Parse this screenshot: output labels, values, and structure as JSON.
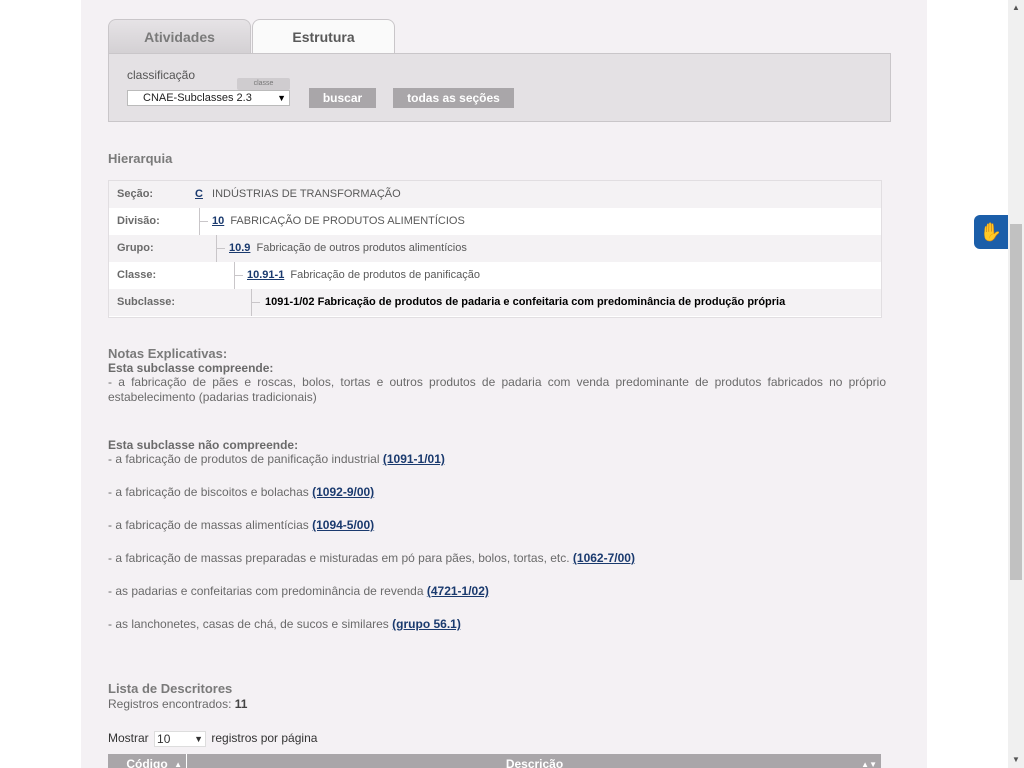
{
  "tabs": {
    "atividades": "Atividades",
    "estrutura": "Estrutura"
  },
  "search": {
    "label": "classificação",
    "tag": "classe",
    "select_value": "CNAE-Subclasses 2.3",
    "buscar": "buscar",
    "todas": "todas as seções"
  },
  "hierarchy": {
    "title": "Hierarquia",
    "rows": [
      {
        "label": "Seção:",
        "code": "C",
        "text": "INDÚSTRIAS DE TRANSFORMAÇÃO"
      },
      {
        "label": "Divisão:",
        "code": "10",
        "text": "FABRICAÇÃO DE PRODUTOS ALIMENTÍCIOS"
      },
      {
        "label": "Grupo:",
        "code": "10.9",
        "text": "Fabricação de outros produtos alimentícios"
      },
      {
        "label": "Classe:",
        "code": "10.91-1",
        "text": "Fabricação de produtos de panificação"
      },
      {
        "label": "Subclasse:",
        "code": "",
        "text": "1091-1/02 Fabricação de produtos de padaria e confeitaria com predominância de produção própria"
      }
    ]
  },
  "notes": {
    "title": "Notas Explicativas:",
    "comp_title": "Esta subclasse compreende:",
    "comp_text": "- a fabricação de pães e roscas, bolos, tortas e outros produtos de padaria com venda predominante de produtos fabricados no próprio estabelecimento (padarias tradicionais)",
    "nao_title": "Esta subclasse não compreende:",
    "nao_items": [
      {
        "text": "- a fabricação de produtos de panificação industrial ",
        "link": "(1091-1/01)"
      },
      {
        "text": "- a fabricação de biscoitos e bolachas ",
        "link": "(1092-9/00)"
      },
      {
        "text": "- a fabricação de massas alimentícias ",
        "link": "(1094-5/00)"
      },
      {
        "text": "- a fabricação de massas preparadas e misturadas em pó para pães, bolos, tortas, etc. ",
        "link": "(1062-7/00)"
      },
      {
        "text": "- as padarias e confeitarias com predominância de revenda ",
        "link": "(4721-1/02)"
      },
      {
        "text": "- as lanchonetes, casas de chá, de sucos e similares ",
        "link": "(grupo 56.1)"
      }
    ]
  },
  "lista": {
    "title": "Lista de Descritores",
    "reg_label": "Registros encontrados: ",
    "reg_count": "11",
    "mostrar": "Mostrar",
    "per_page": "10",
    "registros": "registros por página",
    "col_codigo": "Código",
    "col_descricao": "Descrição"
  },
  "icons": {
    "vlibras": "hands-sign-language-icon"
  }
}
